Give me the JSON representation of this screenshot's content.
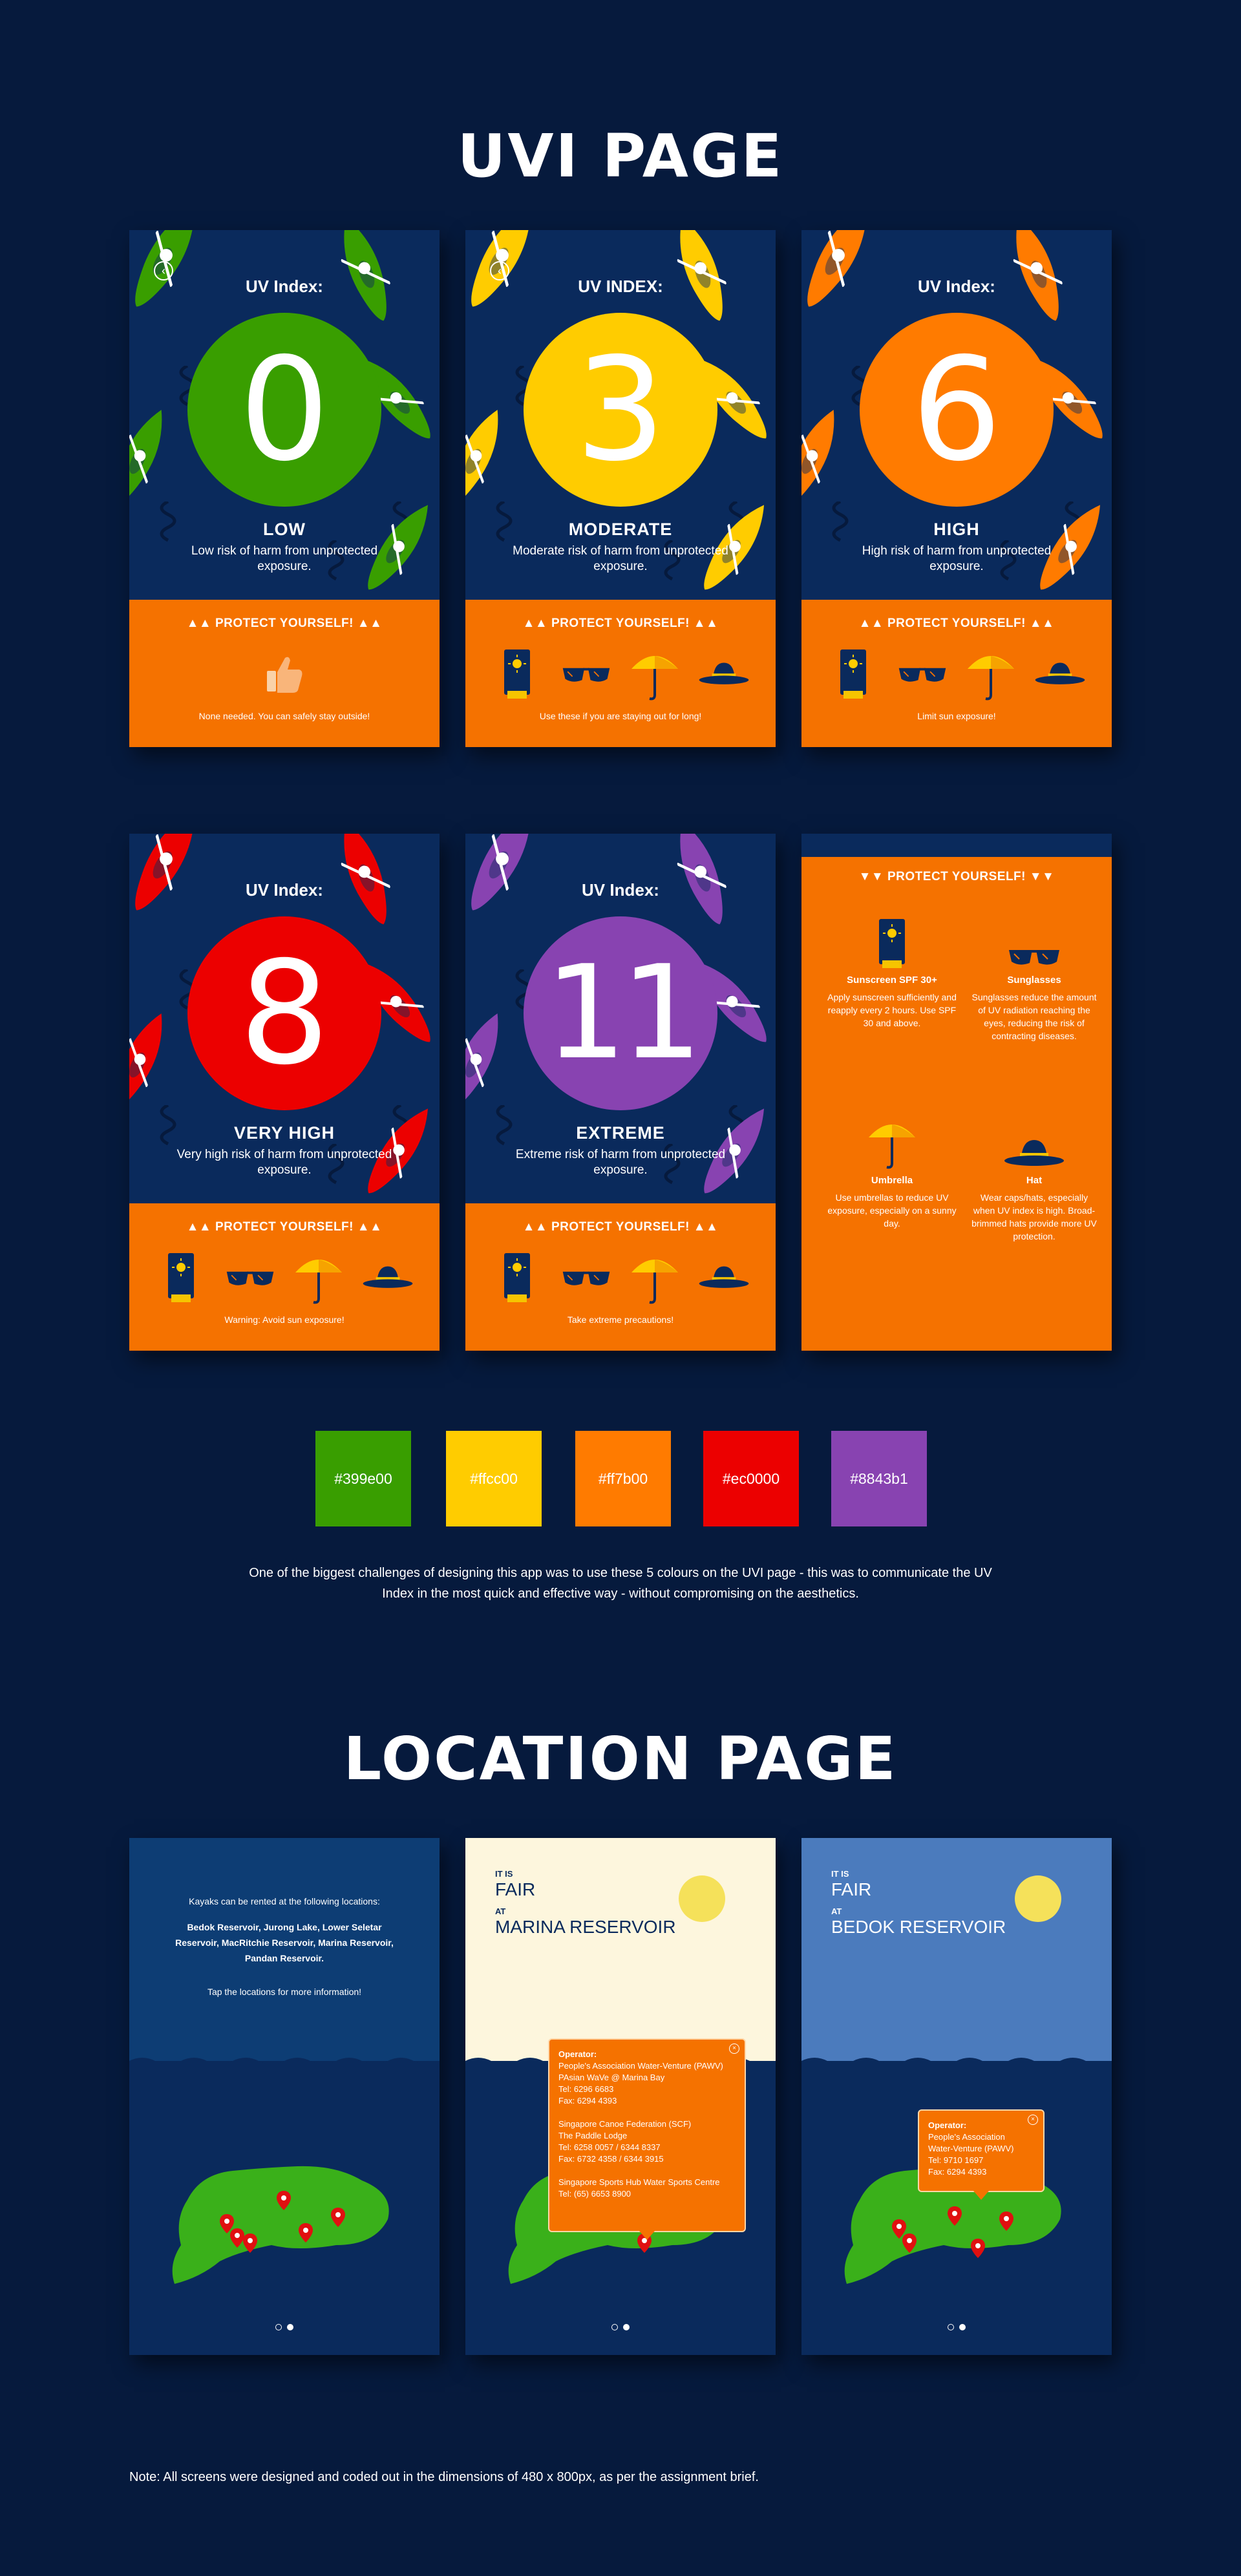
{
  "uvi_section": {
    "title": "UVI PAGE"
  },
  "uv_screens": [
    {
      "title": "UV Index:",
      "value": "0",
      "level": "LOW",
      "description": "Low risk of harm from unprotected exposure.",
      "color": "#399e00",
      "protect": "▲▲ PROTECT YOURSELF! ▲▲",
      "note": "None needed. You can safely stay outside!",
      "icons": [
        "thumbs-up-icon"
      ],
      "has_back": true
    },
    {
      "title": "UV INDEX:",
      "value": "3",
      "level": "MODERATE",
      "description": "Moderate risk of harm from unprotected exposure.",
      "color": "#ffcc00",
      "protect": "▲▲ PROTECT YOURSELF! ▲▲",
      "note": "Use these if you are staying out for long!",
      "icons": [
        "sunscreen-icon",
        "sunglasses-icon",
        "umbrella-icon",
        "hat-icon"
      ],
      "has_back": true
    },
    {
      "title": "UV Index:",
      "value": "6",
      "level": "HIGH",
      "description": "High risk of harm from unprotected exposure.",
      "color": "#ff7b00",
      "protect": "▲▲ PROTECT YOURSELF! ▲▲",
      "note": "Limit sun exposure!",
      "icons": [
        "sunscreen-icon",
        "sunglasses-icon",
        "umbrella-icon",
        "hat-icon"
      ],
      "has_back": false
    },
    {
      "title": "UV Index:",
      "value": "8",
      "level": "VERY HIGH",
      "description": "Very high risk of harm from unprotected exposure.",
      "color": "#ec0000",
      "protect": "▲▲ PROTECT YOURSELF! ▲▲",
      "note": "Warning: Avoid sun exposure!",
      "icons": [
        "sunscreen-icon",
        "sunglasses-icon",
        "umbrella-icon",
        "hat-icon"
      ],
      "has_back": false
    },
    {
      "title": "UV Index:",
      "value": "11",
      "level": "EXTREME",
      "description": "Extreme risk of harm from unprotected exposure.",
      "color": "#8843b1",
      "protect": "▲▲ PROTECT YOURSELF! ▲▲",
      "note": "Take extreme precautions!",
      "icons": [
        "sunscreen-icon",
        "sunglasses-icon",
        "umbrella-icon",
        "hat-icon"
      ],
      "has_back": false
    }
  ],
  "tips_screen": {
    "protect": "▼▼ PROTECT YOURSELF! ▼▼",
    "tips": [
      {
        "icon": "sunscreen-icon",
        "title": "Sunscreen SPF 30+",
        "desc": "Apply sunscreen sufficiently and reapply every 2 hours. Use SPF 30 and above."
      },
      {
        "icon": "sunglasses-icon",
        "title": "Sunglasses",
        "desc": "Sunglasses reduce the amount of UV radiation reaching the eyes, reducing the risk of contracting diseases."
      },
      {
        "icon": "umbrella-icon",
        "title": "Umbrella",
        "desc": "Use umbrellas to reduce UV exposure, especially on a sunny day."
      },
      {
        "icon": "hat-icon",
        "title": "Hat",
        "desc": "Wear caps/hats, especially when UV index is high. Broad-brimmed hats provide more UV protection."
      }
    ]
  },
  "swatches": [
    "#399e00",
    "#ffcc00",
    "#ff7b00",
    "#ec0000",
    "#8843b1"
  ],
  "colour_note": "One of the biggest challenges of designing this app was to use these 5 colours on the UVI page - this was to communicate the UV Index in the most quick and effective way - without compromising on the aesthetics.",
  "location_section": {
    "title": "LOCATION PAGE"
  },
  "location_screens": {
    "intro": {
      "text1": "Kayaks can be rented at the following locations:",
      "text2": "Bedok Reservoir, Jurong Lake, Lower Seletar Reservoir, MacRitchie Reservoir, Marina Reservoir, Pandan Reservoir.",
      "text3": "Tap the locations for more information!"
    },
    "marina": {
      "it_is": "IT IS",
      "weather": "FAIR",
      "at": "AT",
      "place": "MARINA RESERVOIR",
      "popup": [
        "Operator:",
        "People's Association Water-Venture (PAWV)",
        "PAsian WaVe @ Marina Bay",
        "Tel: 6296 6683",
        "Fax: 6294 4393",
        "",
        "Singapore Canoe Federation (SCF)",
        "The Paddle Lodge",
        "Tel: 6258 0057 / 6344 8337",
        "Fax: 6732 4358 / 6344 3915",
        "",
        "Singapore Sports Hub Water Sports Centre",
        "Tel: (65) 6653 8900"
      ]
    },
    "bedok": {
      "it_is": "IT IS",
      "weather": "FAIR",
      "at": "AT",
      "place": "BEDOK RESERVOIR",
      "popup": [
        "Operator:",
        "People's Association",
        "Water-Venture (PAWV)",
        "Tel: 9710 1697",
        "Fax: 6294 4393"
      ]
    }
  },
  "footnote": "Note: All screens were designed and coded out in the dimensions of 480 x 800px, as per the assignment brief."
}
